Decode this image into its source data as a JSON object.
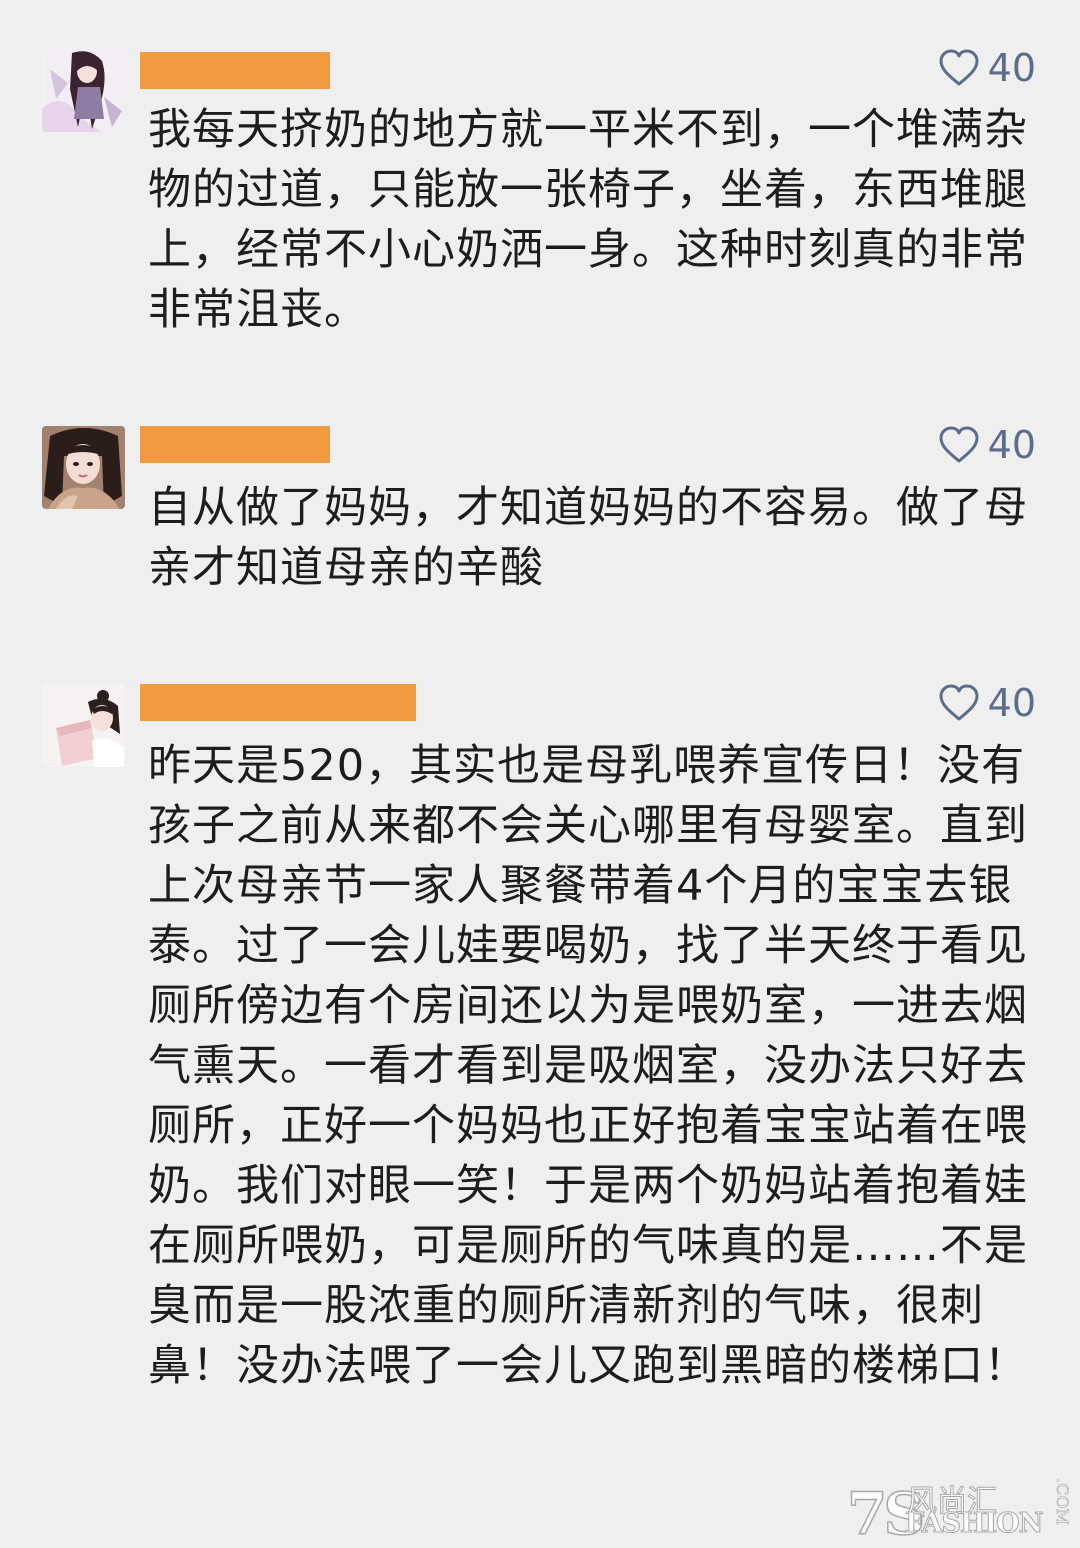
{
  "comments": [
    {
      "likes": "40",
      "text": "我每天挤奶的地方就一平米不到，一个堆满杂物的过道，只能放一张椅子，坐着，东西堆腿上，经常不小心奶洒一身。这种时刻真的非常非常沮丧。"
    },
    {
      "likes": "40",
      "text": "自从做了妈妈，才知道妈妈的不容易。做了母亲才知道母亲的辛酸"
    },
    {
      "likes": "40",
      "text": "昨天是520，其实也是母乳喂养宣传日！没有孩子之前从来都不会关心哪里有母婴室。直到上次母亲节一家人聚餐带着4个月的宝宝去银泰。过了一会儿娃要喝奶，找了半天终于看见厕所傍边有个房间还以为是喂奶室，一进去烟气熏天。一看才看到是吸烟室，没办法只好去厕所，正好一个妈妈也正好抱着宝宝站着在喂奶。我们对眼一笑！于是两个奶妈站着抱着娃在厕所喂奶，可是厕所的气味真的是……不是臭而是一股浓重的厕所清新剂的气味，很刺鼻！没办法喂了一会儿又跑到黑暗的楼梯口！"
    }
  ],
  "watermark": {
    "mark": "7S",
    "cn": "风尚汇",
    "en": "FASHION",
    "suffix": ".COM"
  },
  "colors": {
    "background": "#efefef",
    "name_redaction": "#f29a40",
    "like_color": "#5b6d8c",
    "text": "#1d1d1d"
  },
  "icons": {
    "like": "heart-outline-icon"
  }
}
